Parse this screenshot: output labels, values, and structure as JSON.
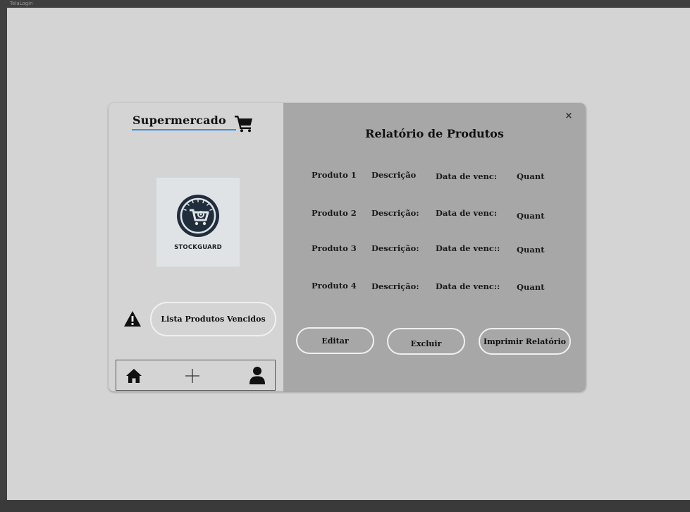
{
  "window": {
    "title": "TelaLogin"
  },
  "sidebar": {
    "brand": "Supermercado",
    "logo_text": "STOCKGUARD",
    "expired_button_label": "Lista Produtos Vencidos"
  },
  "report": {
    "title": "Relatório de Produtos",
    "close_label": "×",
    "rows": [
      {
        "product": "Produto 1",
        "description": "Descrição",
        "expiry": "Data de venc:",
        "quantity": "Quant"
      },
      {
        "product": "Produto 2",
        "description": "Descrição:",
        "expiry": "Data de venc:",
        "quantity": "Quant"
      },
      {
        "product": "Produto 3",
        "description": "Descrição:",
        "expiry": "Data de venc::",
        "quantity": "Quant"
      },
      {
        "product": "Produto 4",
        "description": "Descrição:",
        "expiry": "Data de venc::",
        "quantity": "Quant"
      }
    ],
    "buttons": {
      "edit": "Editar",
      "delete": "Excluir",
      "print": "Imprimir Relatório"
    }
  },
  "icons": {
    "cart": "cart-icon",
    "warning": "warning-icon",
    "home": "home-icon",
    "add": "plus-icon",
    "user": "user-icon",
    "close": "close-icon"
  },
  "colors": {
    "left_panel": "#d4d4d4",
    "right_panel": "#a7a7a7",
    "brand_underline": "#3e8ed8",
    "button_border": "#f0f0f0"
  }
}
